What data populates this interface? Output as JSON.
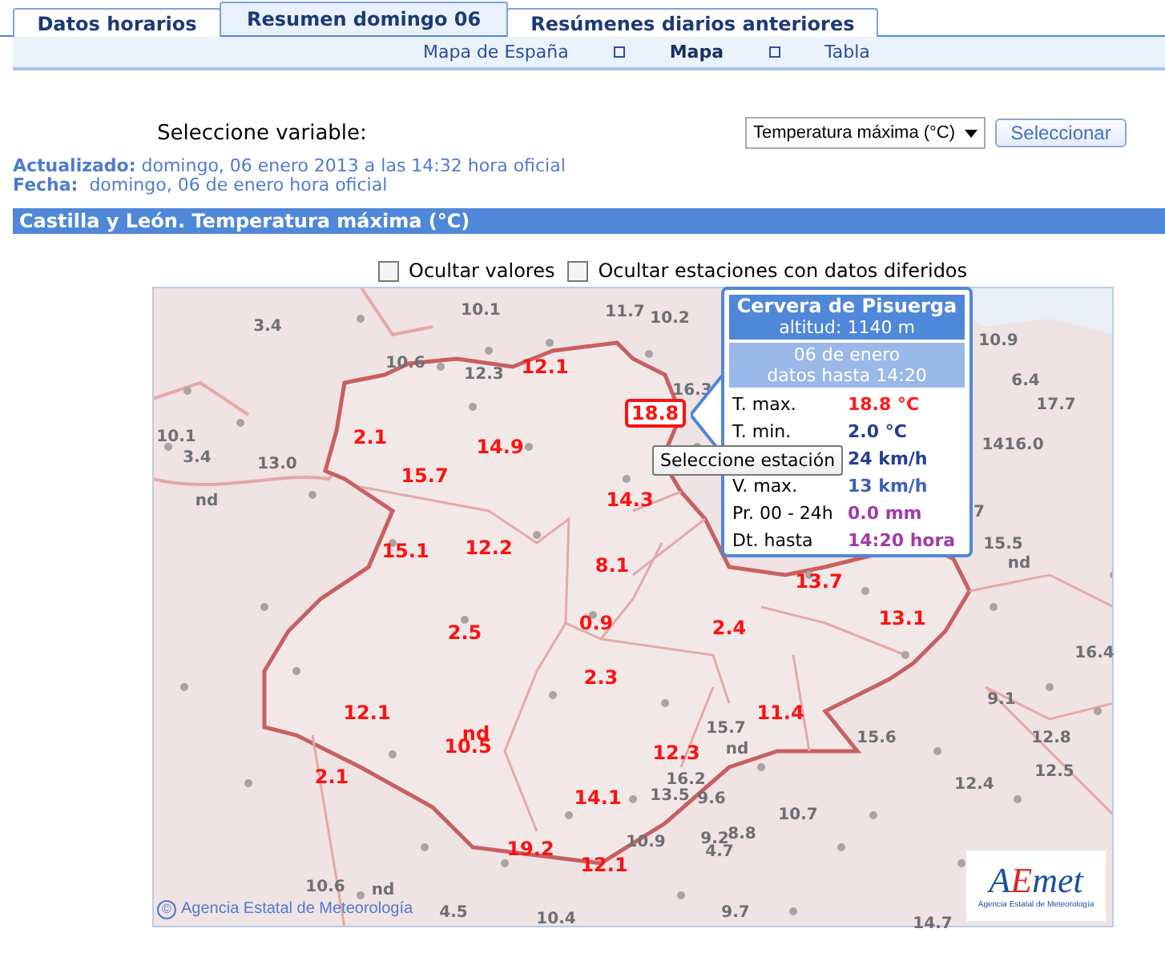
{
  "tabs": [
    {
      "label": "Datos horarios",
      "selected": false
    },
    {
      "label": "Resumen domingo 06",
      "selected": true
    },
    {
      "label": "Resúmenes diarios anteriores",
      "selected": false
    }
  ],
  "subnav": [
    {
      "label": "Mapa de España",
      "selected": false
    },
    {
      "label": "Mapa",
      "selected": true
    },
    {
      "label": "Tabla",
      "selected": false
    }
  ],
  "variable_label": "Seleccione variable:",
  "variable_select": {
    "value": "Temperatura máxima (°C)"
  },
  "select_button": "Seleccionar",
  "updated": {
    "label": "Actualizado:",
    "value": "domingo, 06 enero 2013 a las 14:32 hora oficial"
  },
  "date": {
    "label": "Fecha:",
    "value": "domingo, 06 de enero hora oficial"
  },
  "section_title": "Castilla y León. Temperatura máxima (°C)",
  "checkboxes": [
    {
      "label": "Ocultar valores",
      "checked": false
    },
    {
      "label": "Ocultar estaciones con datos diferidos",
      "checked": false
    }
  ],
  "map": {
    "labels": [
      {
        "text": "3.4",
        "kind": "other"
      },
      {
        "text": "10.1",
        "kind": "other"
      },
      {
        "text": "11.7",
        "kind": "other"
      },
      {
        "text": "10.2",
        "kind": "other"
      },
      {
        "text": "10.6",
        "kind": "other"
      },
      {
        "text": "12.3",
        "kind": "other"
      },
      {
        "text": "16.3",
        "kind": "other"
      },
      {
        "text": "10.9",
        "kind": "other"
      },
      {
        "text": "6.4",
        "kind": "other"
      },
      {
        "text": "17.7",
        "kind": "other"
      },
      {
        "text": "10.1",
        "kind": "other"
      },
      {
        "text": "3.4",
        "kind": "other"
      },
      {
        "text": "13.0",
        "kind": "other"
      },
      {
        "text": "nd",
        "kind": "other"
      },
      {
        "text": "1416.0",
        "kind": "other"
      },
      {
        "text": "7",
        "kind": "other"
      },
      {
        "text": "15.5",
        "kind": "other"
      },
      {
        "text": "nd",
        "kind": "other"
      },
      {
        "text": "16.4",
        "kind": "other"
      },
      {
        "text": "9.1",
        "kind": "other"
      },
      {
        "text": "12.8",
        "kind": "other"
      },
      {
        "text": "12.5",
        "kind": "other"
      },
      {
        "text": "12.4",
        "kind": "other"
      },
      {
        "text": "15.6",
        "kind": "other"
      },
      {
        "text": "15.7",
        "kind": "other"
      },
      {
        "text": "nd",
        "kind": "other"
      },
      {
        "text": "16.2",
        "kind": "other"
      },
      {
        "text": "13.5",
        "kind": "other"
      },
      {
        "text": "9.6",
        "kind": "other"
      },
      {
        "text": "10.7",
        "kind": "other"
      },
      {
        "text": "10.9",
        "kind": "other"
      },
      {
        "text": "8.8",
        "kind": "other"
      },
      {
        "text": "9.2",
        "kind": "other"
      },
      {
        "text": "4.7",
        "kind": "other"
      },
      {
        "text": "9.7",
        "kind": "other"
      },
      {
        "text": "14.7",
        "kind": "other"
      },
      {
        "text": "10.6",
        "kind": "other"
      },
      {
        "text": "nd",
        "kind": "other"
      },
      {
        "text": "4.5",
        "kind": "other"
      },
      {
        "text": "10.4",
        "kind": "other"
      },
      {
        "text": "12.1",
        "kind": "region"
      },
      {
        "text": "2.1",
        "kind": "region"
      },
      {
        "text": "14.9",
        "kind": "region"
      },
      {
        "text": "15.7",
        "kind": "region"
      },
      {
        "text": "14.3",
        "kind": "region"
      },
      {
        "text": "15.1",
        "kind": "region"
      },
      {
        "text": "12.2",
        "kind": "region"
      },
      {
        "text": "8.1",
        "kind": "region"
      },
      {
        "text": "2.5",
        "kind": "region"
      },
      {
        "text": "0.9",
        "kind": "region"
      },
      {
        "text": "2.4",
        "kind": "region"
      },
      {
        "text": "13.7",
        "kind": "region"
      },
      {
        "text": "13.1",
        "kind": "region"
      },
      {
        "text": "2.3",
        "kind": "region"
      },
      {
        "text": "12.1",
        "kind": "region"
      },
      {
        "text": "nd",
        "kind": "region"
      },
      {
        "text": "10.5",
        "kind": "region"
      },
      {
        "text": "11.4",
        "kind": "region"
      },
      {
        "text": "12.3",
        "kind": "region"
      },
      {
        "text": "2.1",
        "kind": "region"
      },
      {
        "text": "14.1",
        "kind": "region"
      },
      {
        "text": "19.2",
        "kind": "region"
      },
      {
        "text": "12.1",
        "kind": "region"
      }
    ],
    "selected_station": "18.8",
    "hover_tip": "Seleccione estación",
    "tooltip": {
      "name": "Cervera de Pisuerga",
      "altitude": "altitud: 1140 m",
      "date": "06 de enero",
      "data_until": "datos hasta  14:20",
      "rows": [
        {
          "label": "T. max.",
          "value": "18.8 °C",
          "kind": "temp_max"
        },
        {
          "label": "T. min.",
          "value": "2.0 °C",
          "kind": "temp_min"
        },
        {
          "value": "24 km/h",
          "kind": "wind"
        },
        {
          "label": "V. max.",
          "value": "13 km/h",
          "kind": "gust"
        },
        {
          "label": "Pr. 00 - 24h",
          "value": "0.0 mm",
          "kind": "precip"
        },
        {
          "label": "Dt. hasta",
          "value": "14:20 hora",
          "kind": "time"
        }
      ]
    },
    "credit_symbol": "©",
    "credit": "Agencia Estatal de Meteorología",
    "logo": {
      "first": "A",
      "accent": "E",
      "rest": "met",
      "subtitle": "Agencia Estatal de Meteorología"
    }
  }
}
